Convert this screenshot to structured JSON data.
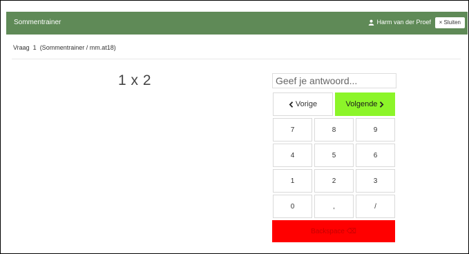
{
  "header": {
    "app_title": "Sommentrainer",
    "user_name": "Harm van der Proef",
    "close_label": "× Sluiten"
  },
  "breadcrumb": "Vraag  1  (Sommentrainer / mm.at18)",
  "question": "1 x 2",
  "answer": {
    "placeholder": "Geef je antwoord...",
    "value": ""
  },
  "nav": {
    "prev_label": "Vorige",
    "next_label": "Volgende"
  },
  "keypad": {
    "rows": [
      [
        "7",
        "8",
        "9"
      ],
      [
        "4",
        "5",
        "6"
      ],
      [
        "1",
        "2",
        "3"
      ],
      [
        "0",
        ",",
        "/"
      ]
    ],
    "backspace_label": "Backspace ⌫"
  },
  "colors": {
    "header_bg": "#5f8a57",
    "next_button_bg": "#8cf529",
    "backspace_bg": "#ff0000"
  },
  "icons": {
    "user": "user-icon",
    "prev": "chevron-left-icon",
    "next": "chevron-right-icon"
  }
}
